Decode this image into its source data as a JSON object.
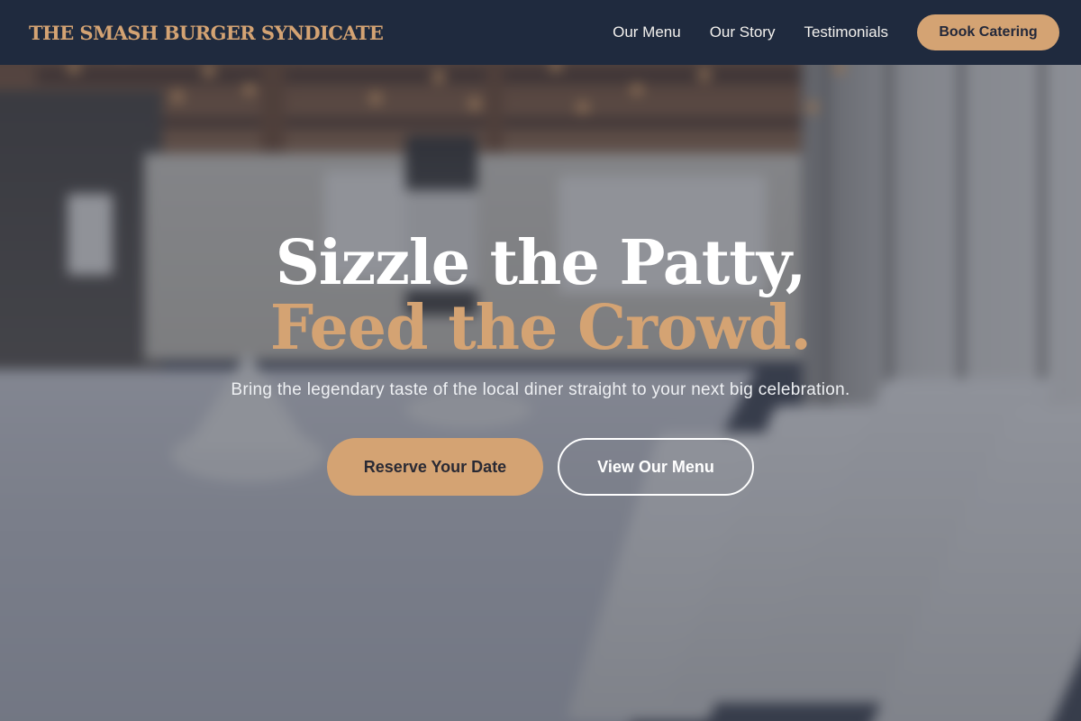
{
  "nav": {
    "brand": "THE SMASH BURGER SYNDICATE",
    "links": [
      "Our Menu",
      "Our Story",
      "Testimonials"
    ],
    "cta": "Book Catering"
  },
  "hero": {
    "headline_line1": "Sizzle the Patty,",
    "headline_line2": "Feed the Crowd.",
    "subtitle": "Bring the legendary taste of the local diner straight to your next big celebration.",
    "primary_button": "Reserve Your Date",
    "secondary_button": "View Our Menu"
  },
  "colors": {
    "nav_background": "#1f2a3e",
    "accent": "#d4a373",
    "overlay": "#363c4c"
  }
}
